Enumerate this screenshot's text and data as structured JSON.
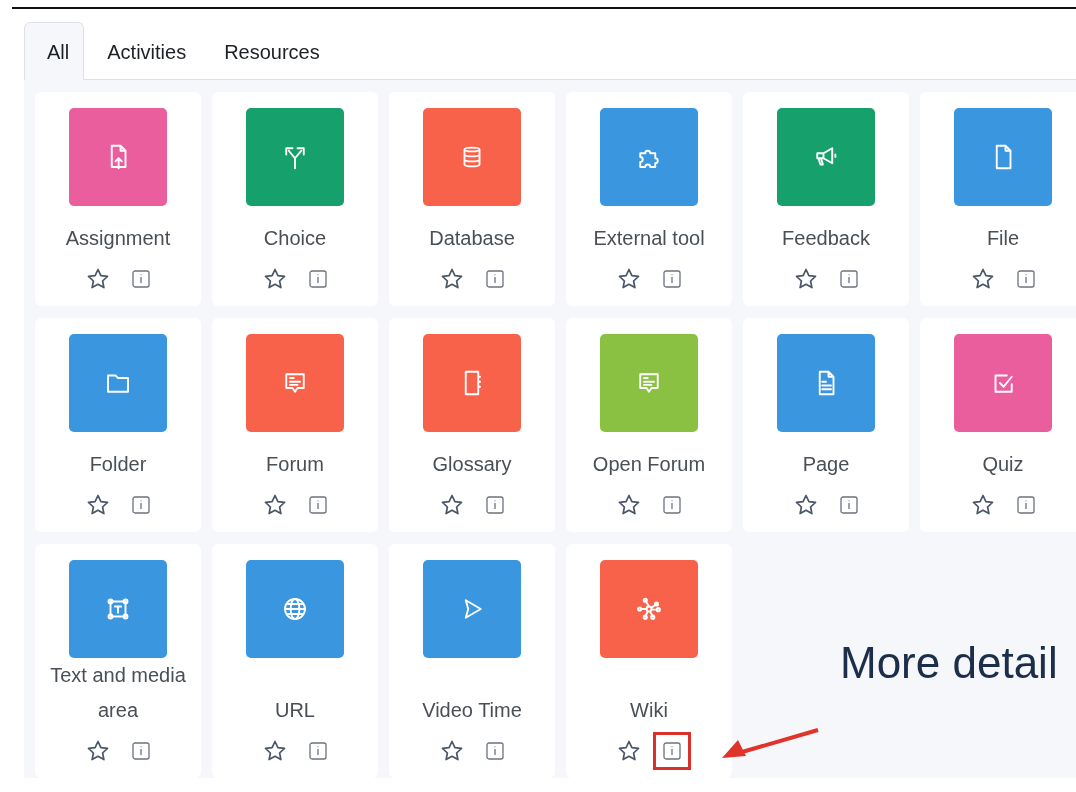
{
  "tabs": [
    {
      "label": "All",
      "selected": true
    },
    {
      "label": "Activities",
      "selected": false
    },
    {
      "label": "Resources",
      "selected": false
    }
  ],
  "items": [
    {
      "label": "Assignment",
      "kind": "upload",
      "color": "#eb5e9e",
      "starred": false,
      "highlighted": false
    },
    {
      "label": "Choice",
      "kind": "split",
      "color": "#16a06c",
      "starred": false,
      "highlighted": false
    },
    {
      "label": "Database",
      "kind": "database",
      "color": "#f8624b",
      "starred": false,
      "highlighted": false
    },
    {
      "label": "External tool",
      "kind": "puzzle",
      "color": "#3a96de",
      "starred": false,
      "highlighted": false
    },
    {
      "label": "Feedback",
      "kind": "megaphone",
      "color": "#16a06c",
      "starred": false,
      "highlighted": false
    },
    {
      "label": "File",
      "kind": "file",
      "color": "#3a96de",
      "starred": false,
      "highlighted": false
    },
    {
      "label": "Folder",
      "kind": "folder",
      "color": "#3a96de",
      "starred": false,
      "highlighted": false
    },
    {
      "label": "Forum",
      "kind": "chat",
      "color": "#f8624b",
      "starred": false,
      "highlighted": false
    },
    {
      "label": "Glossary",
      "kind": "notebook",
      "color": "#f8624b",
      "starred": false,
      "highlighted": false
    },
    {
      "label": "Open Forum",
      "kind": "chat",
      "color": "#8bc143",
      "starred": false,
      "highlighted": false
    },
    {
      "label": "Page",
      "kind": "document",
      "color": "#3a96de",
      "starred": false,
      "highlighted": false
    },
    {
      "label": "Quiz",
      "kind": "checkbox",
      "color": "#eb5e9e",
      "starred": false,
      "highlighted": false
    },
    {
      "label": "Text and media area",
      "kind": "textbox",
      "color": "#3a96de",
      "starred": false,
      "highlighted": false
    },
    {
      "label": "URL",
      "kind": "globe",
      "color": "#3a96de",
      "starred": false,
      "highlighted": false
    },
    {
      "label": "Video Time",
      "kind": "play",
      "color": "#3a96de",
      "starred": false,
      "highlighted": false
    },
    {
      "label": "Wiki",
      "kind": "network",
      "color": "#f8624b",
      "starred": false,
      "highlighted": true
    }
  ],
  "annotation": {
    "text": "More detail"
  }
}
